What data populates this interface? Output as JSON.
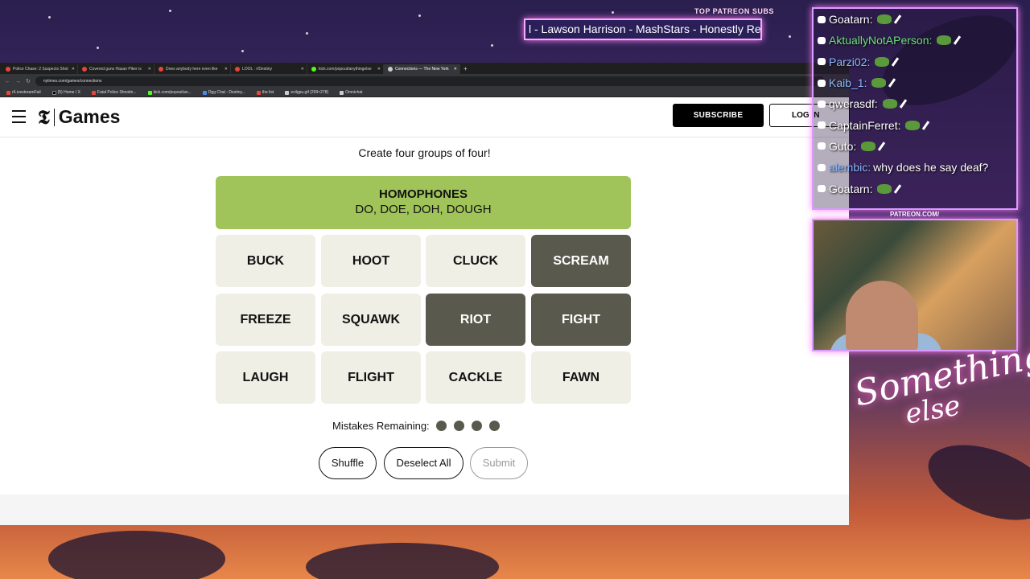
{
  "overlay": {
    "ticker_label": "TOP PATREON SUBS",
    "ticker_text": "l - Lawson Harrison - MashStars - Honestly Re",
    "chat": [
      {
        "name": "Goatarn:",
        "color": "#ffffff",
        "text": ""
      },
      {
        "name": "AktuallyNotAPerson:",
        "color": "#6be07a",
        "text": ""
      },
      {
        "name": "Parzi02:",
        "color": "#8ab8ff",
        "text": ""
      },
      {
        "name": "Kaib_1:",
        "color": "#8ab8ff",
        "text": ""
      },
      {
        "name": "qwerasdf:",
        "color": "#ffffff",
        "text": ""
      },
      {
        "name": "CaptainFerret:",
        "color": "#ffffff",
        "text": ""
      },
      {
        "name": "Guto:",
        "color": "#ffffff",
        "text": ""
      },
      {
        "name": "alembic:",
        "color": "#8ab8ff",
        "text": "why does he say deaf?"
      },
      {
        "name": "Goatarn:",
        "color": "#ffffff",
        "text": ""
      }
    ],
    "patreon_label": "PATREON.COM/",
    "signature_line1": "Something",
    "signature_line2": "else"
  },
  "browser": {
    "tabs": [
      "Police Chase: 2 Suspects Shot",
      "Covered guns Hasan Piker is",
      "Does anybody here even like",
      "LOOL : r/Destiny",
      "kick.com/popout/anythingelse",
      "Connections — The New York"
    ],
    "active_tab": 5,
    "url": "nytimes.com/games/connections",
    "bookmarks": [
      "r/LivestreamFail",
      "(5) Home / X",
      "Fatal Police Shootin...",
      "kick.com/popout/an...",
      "Dgg Chat - Destiny...",
      "the list",
      "evilgpu.gif (299×278)",
      "Omnichat"
    ]
  },
  "site": {
    "brand": "Games",
    "subscribe": "SUBSCRIBE",
    "login": "LOG IN"
  },
  "game": {
    "subtitle": "Create four groups of four!",
    "solved": {
      "category": "HOMOPHONES",
      "words": "DO, DOE, DOH, DOUGH",
      "color": "#a0c35a"
    },
    "tiles": [
      {
        "word": "BUCK",
        "selected": false
      },
      {
        "word": "HOOT",
        "selected": false
      },
      {
        "word": "CLUCK",
        "selected": false
      },
      {
        "word": "SCREAM",
        "selected": true
      },
      {
        "word": "FREEZE",
        "selected": false
      },
      {
        "word": "SQUAWK",
        "selected": false
      },
      {
        "word": "RIOT",
        "selected": true
      },
      {
        "word": "FIGHT",
        "selected": true
      },
      {
        "word": "LAUGH",
        "selected": false
      },
      {
        "word": "FLIGHT",
        "selected": false
      },
      {
        "word": "CACKLE",
        "selected": false
      },
      {
        "word": "FAWN",
        "selected": false
      }
    ],
    "mistakes_label": "Mistakes Remaining:",
    "mistakes_remaining": 4,
    "buttons": {
      "shuffle": "Shuffle",
      "deselect": "Deselect All",
      "submit": "Submit"
    }
  }
}
